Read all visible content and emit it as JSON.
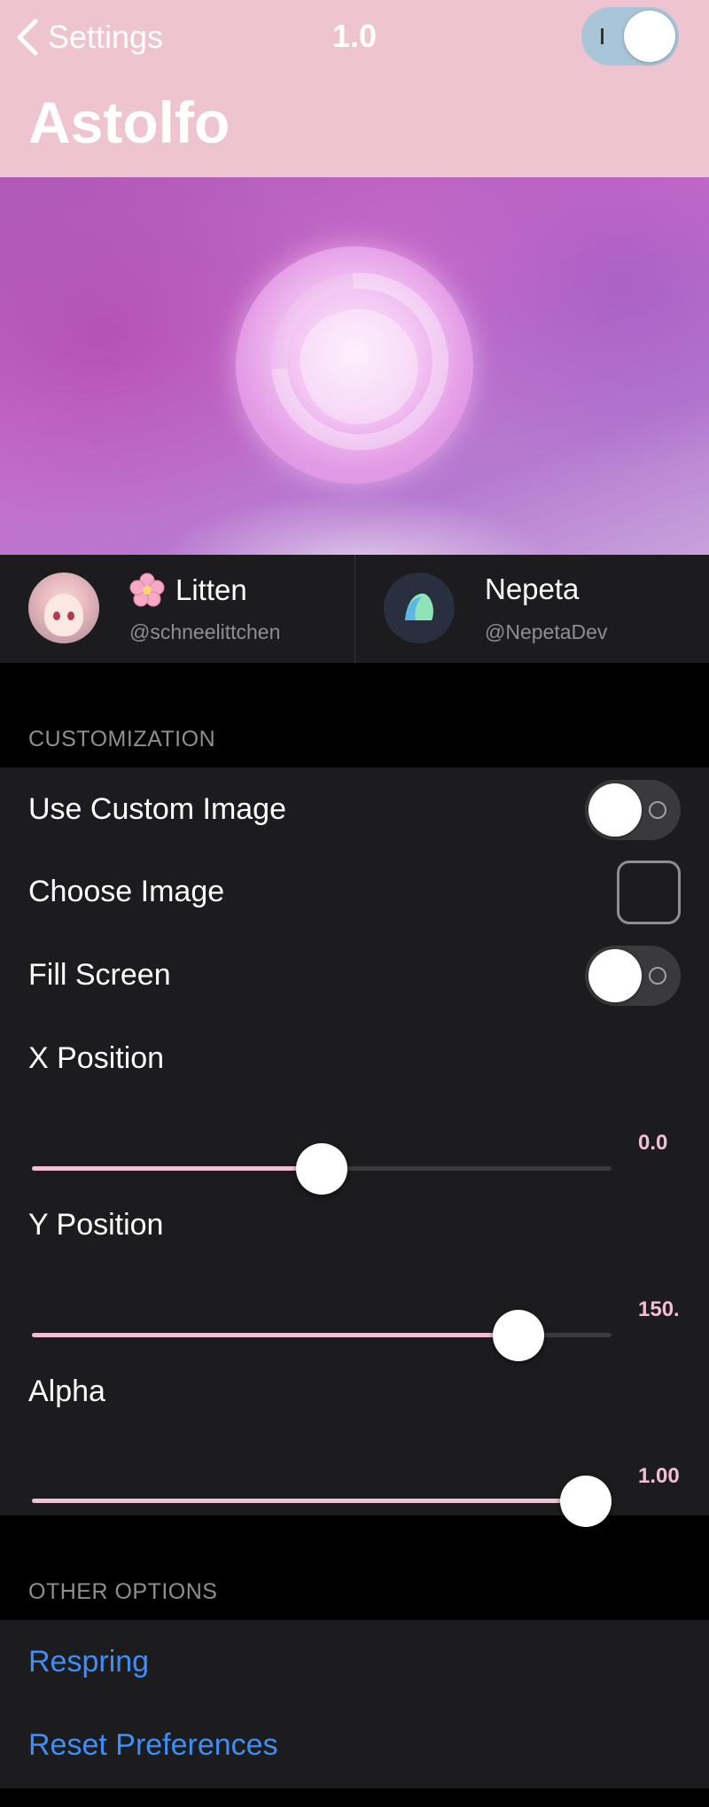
{
  "header": {
    "back_label": "Settings",
    "version": "1.0",
    "enabled": true,
    "title": "Astolfo",
    "background_color": "#edc4cf"
  },
  "credits": [
    {
      "name": "Litten",
      "handle": "@schneelittchen",
      "emoji_icon": "cherry-blossom-icon"
    },
    {
      "name": "Nepeta",
      "handle": "@NepetaDev"
    }
  ],
  "customization": {
    "header": "CUSTOMIZATION",
    "use_custom_image": {
      "label": "Use Custom Image",
      "on": false
    },
    "choose_image": {
      "label": "Choose Image"
    },
    "fill_screen": {
      "label": "Fill Screen",
      "on": false
    },
    "x_position": {
      "label": "X Position",
      "value_text": "0.0",
      "fraction": 0.5
    },
    "y_position": {
      "label": "Y Position",
      "value_text": "150.",
      "fraction": 0.84
    },
    "alpha": {
      "label": "Alpha",
      "value_text": "1.00",
      "fraction": 0.955
    }
  },
  "other_options": {
    "header": "OTHER OPTIONS",
    "respring": "Respring",
    "reset_preferences": "Reset Preferences"
  },
  "colors": {
    "accent_pink": "#f2bfd0",
    "link_blue": "#3f8df5",
    "cell_background": "#1c1c1e"
  }
}
